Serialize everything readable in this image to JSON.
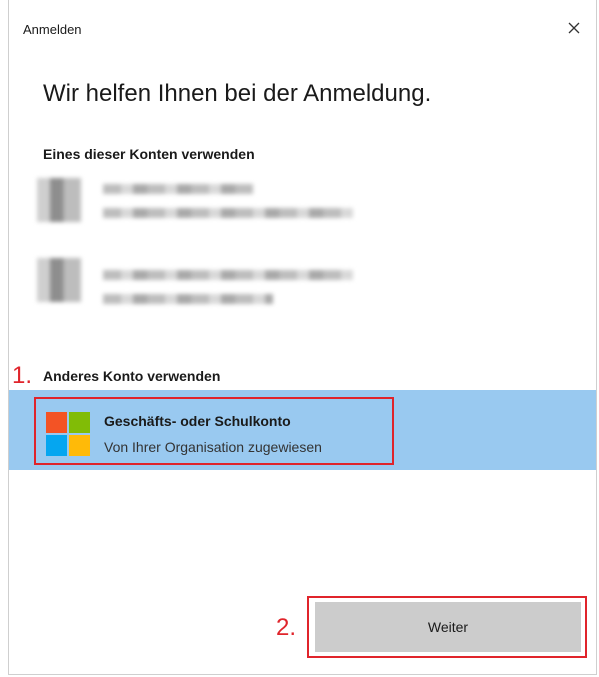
{
  "window": {
    "title": "Anmelden"
  },
  "main": {
    "heading": "Wir helfen Ihnen bei der Anmeldung.",
    "existing_accounts_label": "Eines dieser Konten verwenden",
    "other_account_label": "Anderes Konto verwenden",
    "work_account": {
      "title": "Geschäfts- oder Schulkonto",
      "subtitle": "Von Ihrer Organisation zugewiesen",
      "logo_colors": [
        "#f35325",
        "#81bc06",
        "#05a6f0",
        "#ffba08"
      ]
    },
    "next_button": "Weiter"
  },
  "annotations": {
    "step1": "1.",
    "step2": "2."
  },
  "colors": {
    "selection": "#99c9f0",
    "annotation": "#e0242b",
    "button": "#cccccc"
  }
}
